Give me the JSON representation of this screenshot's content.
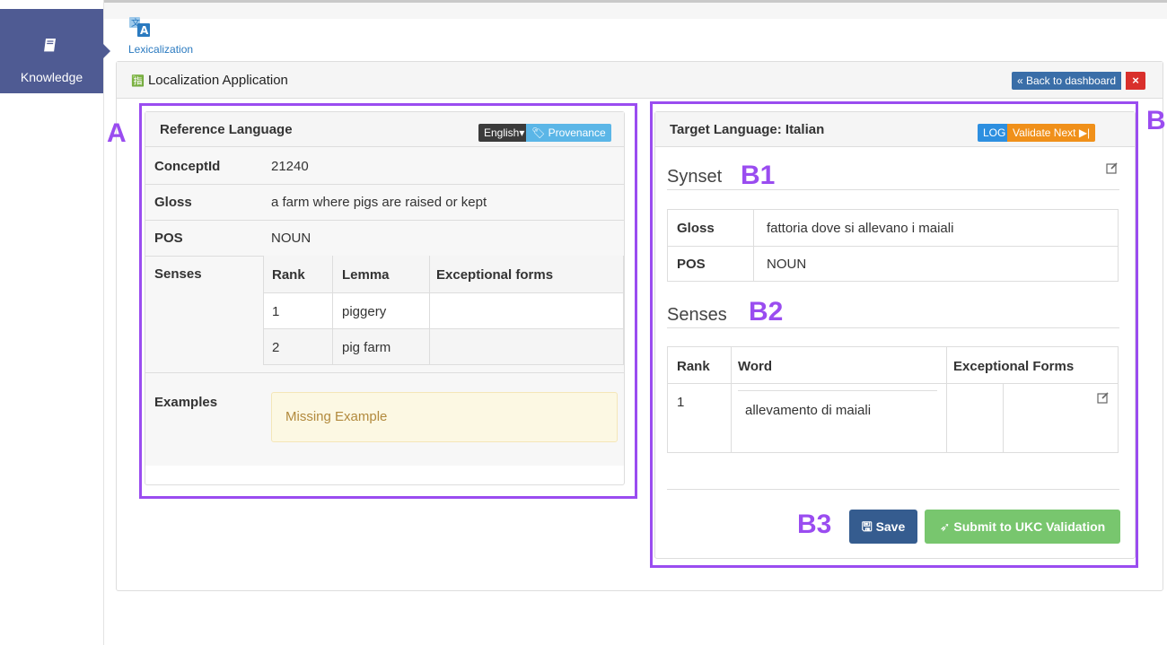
{
  "nav": {
    "item_label": "Knowledge"
  },
  "app": {
    "name": "Lexicalization",
    "panel_title": "Localization Application",
    "back_label": "« Back to dashboard",
    "close_label": "×"
  },
  "reference": {
    "title": "Reference Language",
    "language_button": "English▾",
    "provenance_button": "Provenance",
    "fields": {
      "concept_label": "ConceptId",
      "concept_value": "21240",
      "gloss_label": "Gloss",
      "gloss_value": "a farm where pigs are raised or kept",
      "pos_label": "POS",
      "pos_value": "NOUN",
      "senses_label": "Senses",
      "examples_label": "Examples",
      "examples_value": "Missing Example"
    },
    "senses_table": {
      "headers": [
        "Rank",
        "Lemma",
        "Exceptional forms"
      ],
      "rows": [
        [
          "1",
          "piggery",
          ""
        ],
        [
          "2",
          "pig farm",
          ""
        ]
      ]
    }
  },
  "target": {
    "title": "Target Language: Italian",
    "log_button": "LOG",
    "validate_next_button": "Validate Next ▶|",
    "synset_heading": "Synset",
    "synset": {
      "gloss_label": "Gloss",
      "gloss_value": "fattoria dove si allevano i maiali",
      "pos_label": "POS",
      "pos_value": "NOUN"
    },
    "senses_heading": "Senses",
    "senses_table": {
      "headers": [
        "Rank",
        "Word",
        "Exceptional Forms"
      ],
      "rows": [
        [
          "1",
          "allevamento di maiali",
          ""
        ]
      ]
    },
    "save_button": "Save",
    "submit_button": "Submit to UKC Validation"
  },
  "annotations": {
    "a": "A",
    "b": "B",
    "b1": "B1",
    "b2": "B2",
    "b3": "B3"
  },
  "colors": {
    "nav": "#4f5b93",
    "annotation": "#9a4cf0",
    "save": "#355c8f",
    "submit": "#78c66e",
    "log": "#2d8fe0",
    "validate": "#f0901a"
  }
}
